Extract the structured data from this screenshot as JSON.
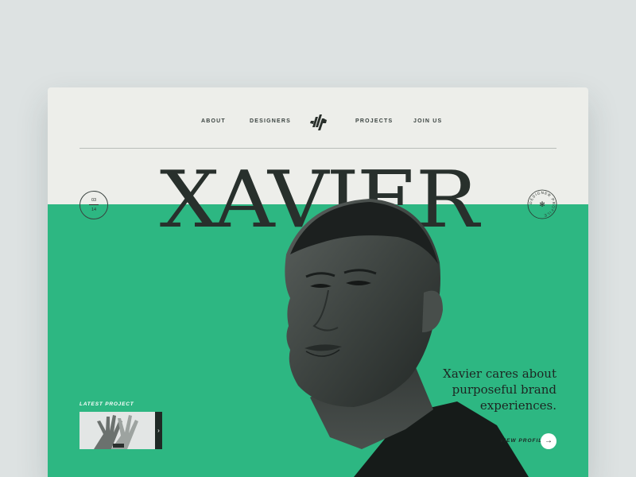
{
  "nav": {
    "items": [
      {
        "label": "ABOUT"
      },
      {
        "label": "DESIGNERS"
      },
      {
        "label": "PROJECTS"
      },
      {
        "label": "JOIN US"
      }
    ],
    "logo_text": "dp"
  },
  "hero": {
    "name": "XAVIER"
  },
  "counter": {
    "current": "03",
    "total": "14"
  },
  "badge": {
    "text": "DESIGNER PROFILE",
    "symbol": "✻"
  },
  "tagline": {
    "line1": "Xavier cares about",
    "line2": "purposeful brand",
    "line3": "experiences."
  },
  "profile_link": {
    "label": "VIEW PROFILE",
    "arrow": "→"
  },
  "latest_project": {
    "label": "LATEST PROJECT",
    "next_icon": "›"
  },
  "colors": {
    "background": "#dde2e2",
    "card": "#edeeea",
    "accent_green": "#2db782",
    "ink": "#28302c"
  }
}
